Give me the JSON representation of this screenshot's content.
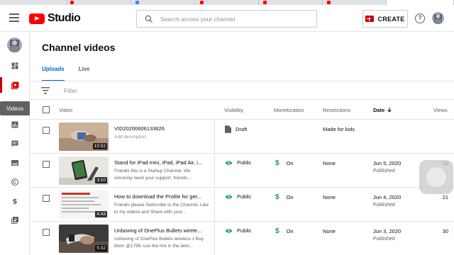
{
  "app": {
    "logo_text": "Studio"
  },
  "search": {
    "placeholder": "Search across your channel"
  },
  "header": {
    "create_label": "CREATE",
    "help_glyph": "?"
  },
  "sidebar": {
    "tooltip": "Videos",
    "items": [
      {
        "icon": "dashboard-icon"
      },
      {
        "icon": "videos-icon",
        "active": true
      },
      {
        "icon": "analytics-icon"
      },
      {
        "icon": "comments-icon"
      },
      {
        "icon": "subtitles-icon"
      },
      {
        "icon": "copyright-icon"
      },
      {
        "icon": "monetization-icon"
      },
      {
        "icon": "audio-library-icon"
      }
    ]
  },
  "page": {
    "title": "Channel videos"
  },
  "tabs": [
    {
      "label": "Uploads"
    },
    {
      "label": "Live"
    }
  ],
  "filter": {
    "placeholder": "Filter"
  },
  "table": {
    "columns": {
      "video": "Video",
      "visibility": "Visibility",
      "monetization": "Monetization",
      "restrictions": "Restrictions",
      "date": "Date",
      "views": "Views"
    },
    "rows": [
      {
        "title": "VID20200606133626",
        "description": "Add description",
        "duration": "15:52",
        "visibility": "Draft",
        "monetization": "",
        "restrictions": "Made for kids",
        "date": "",
        "date_status": "",
        "views": ""
      },
      {
        "title": "Stand for iPad mini, iPad, iPad Air, i...",
        "description": "Friends this is a Startup Channel, We sincerely need your support, friends...",
        "duration": "3:10",
        "visibility": "Public",
        "monetization": "On",
        "restrictions": "None",
        "date": "Jun 5, 2020",
        "date_status": "Published",
        "views": "10"
      },
      {
        "title": "How to download the Profile for get...",
        "description": "Friends please Subscribe to the Channel, Like to my videos and Share with your...",
        "duration": "4:43",
        "visibility": "Public",
        "monetization": "On",
        "restrictions": "None",
        "date": "Jun 4, 2020",
        "date_status": "Published",
        "views": "21"
      },
      {
        "title": "Unboxing of OnePlus Bullets wirele...",
        "description": "Unboxing of OnePlus Bullets wireless z Buy them @1799, use the link in the belo...",
        "duration": "5:32",
        "visibility": "Public",
        "monetization": "On",
        "restrictions": "None",
        "date": "Jun 3, 2020",
        "date_status": "Published",
        "views": "30"
      }
    ]
  },
  "colors": {
    "brand_red": "#ff0000",
    "accent_blue": "#065fd4",
    "public_green": "#0f9d58"
  }
}
